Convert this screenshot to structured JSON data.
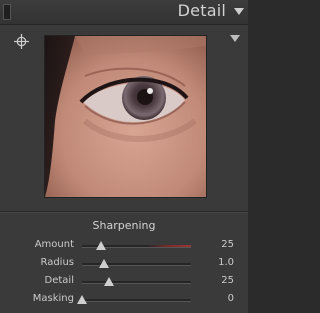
{
  "panel": {
    "title": "Detail"
  },
  "sharpening": {
    "title": "Sharpening",
    "sliders": [
      {
        "label": "Amount",
        "value": "25",
        "fraction": 0.17,
        "accent": "#9b3535"
      },
      {
        "label": "Radius",
        "value": "1.0",
        "fraction": 0.2
      },
      {
        "label": "Detail",
        "value": "25",
        "fraction": 0.25
      },
      {
        "label": "Masking",
        "value": "0",
        "fraction": 0.0
      }
    ]
  },
  "icons": {
    "target": "crosshair-icon",
    "collapse": "triangle-down-icon",
    "panel_toggle": "triangle-down-icon"
  },
  "colors": {
    "panel_bg": "#3a3a3a",
    "header_bg": "#333333",
    "text": "#cacaca",
    "thumb": "#cfcfcf"
  }
}
